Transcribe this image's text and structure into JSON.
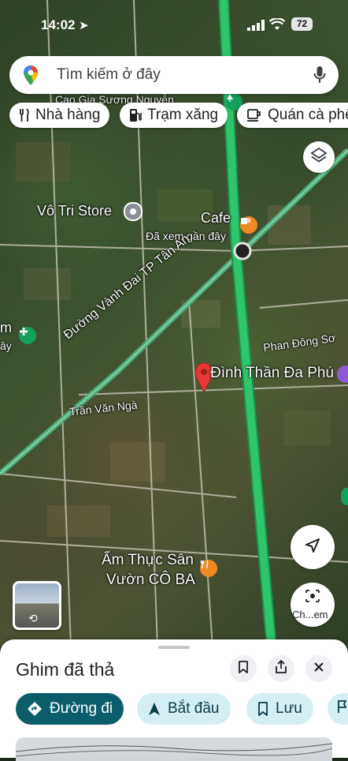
{
  "status_bar": {
    "time": "14:02",
    "battery": "72"
  },
  "search": {
    "placeholder": "Tìm kiếm ở đây"
  },
  "chips": [
    {
      "label": "Nhà hàng",
      "icon": "fork-knife-icon"
    },
    {
      "label": "Trạm xăng",
      "icon": "gas-station-icon"
    },
    {
      "label": "Quán cà phê",
      "icon": "coffee-cup-icon"
    }
  ],
  "map_labels": {
    "top_place": "Cao Gia Sương Nguyễn",
    "store": "Vô Tri Store",
    "cafe": "Cafe",
    "cafe_sub": "Đã xem gần đây",
    "road_diagonal": "Đường Vành Đai TP Tân An",
    "road_phan": "Phan Đông Sơ",
    "road_tran": "Trần Văn Ngà",
    "dropped_pin_place": "Đình Thần Đa Phú",
    "restaurant_line1": "Ẩm Thực Sân",
    "restaurant_line2": "Vườn CÔ BA",
    "left_edge_1": "m",
    "left_edge_2": "ây"
  },
  "controls": {
    "lens_label": "Ch...em"
  },
  "sheet": {
    "title": "Ghim đã thả",
    "actions": [
      {
        "label": "Đường đi",
        "icon": "directions-icon"
      },
      {
        "label": "Bắt đầu",
        "icon": "navigation-arrow-icon"
      },
      {
        "label": "Lưu",
        "icon": "bookmark-icon"
      }
    ]
  },
  "colors": {
    "highway": "#2ec56b",
    "primary": "#0b5d6b",
    "secondary": "#d4eef4",
    "pin": "#e53935"
  }
}
